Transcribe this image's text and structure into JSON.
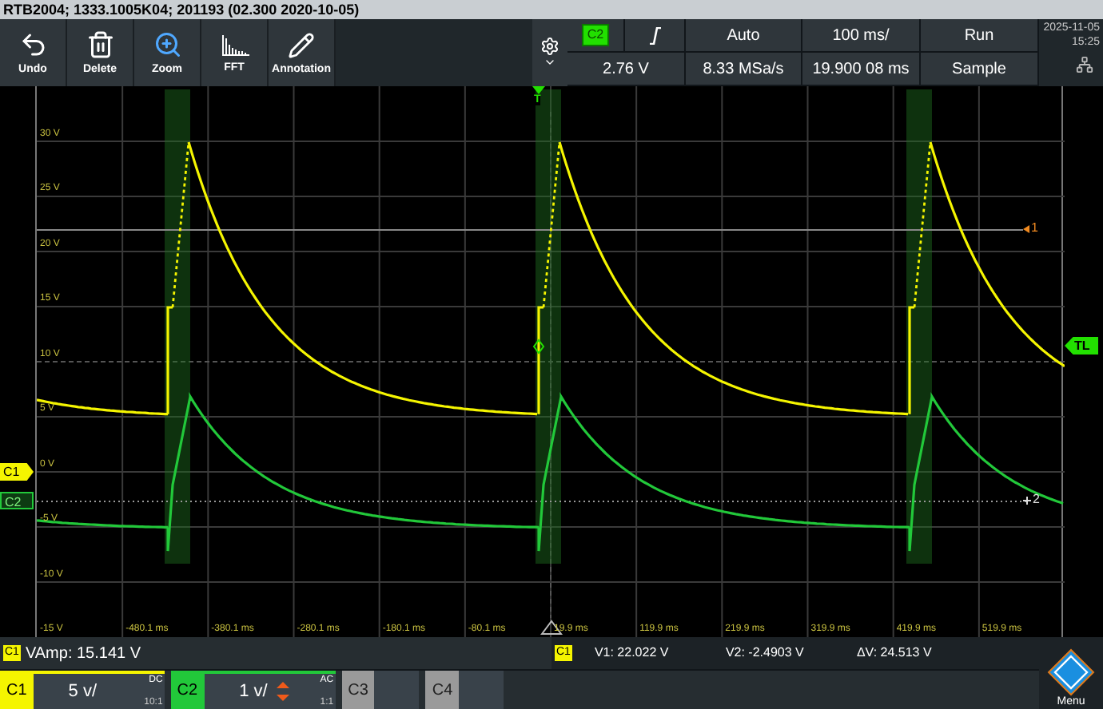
{
  "title_bar": {
    "title": "RTB2004; 1333.1005K04; 201193 (02.300 2020-10-05)"
  },
  "toolbar": [
    {
      "label": "Undo",
      "kind": "undo"
    },
    {
      "label": "Delete",
      "kind": "delete"
    },
    {
      "label": "Zoom",
      "kind": "zoom"
    },
    {
      "label": "FFT",
      "kind": "fft"
    },
    {
      "label": "Annotation",
      "kind": "annotation"
    }
  ],
  "trigger_panel": {
    "source": "C2",
    "level": "2.76 V",
    "mode": "Auto",
    "sample_rate": "8.33 MSa/s",
    "timebase": "100 ms/",
    "position": "19.900 08 ms",
    "run_state": "Run",
    "acquisition": "Sample"
  },
  "datetime": {
    "date": "2025-11-05",
    "time": "15:25"
  },
  "grid": {
    "y_labels": [
      "30 V",
      "25 V",
      "20 V",
      "15 V",
      "10 V",
      "5 V",
      "0 V",
      "-5 V",
      "-10 V",
      "-15 V"
    ],
    "x_labels": [
      "-480.1 ms",
      "-380.1 ms",
      "-280.1 ms",
      "-180.1 ms",
      "-80.1 ms",
      "19.9 ms",
      "119.9 ms",
      "219.9 ms",
      "319.9 ms",
      "419.9 ms",
      "519.9 ms"
    ],
    "markers": {
      "trigger": "T",
      "trigger_level": "TL",
      "cursor_1": "1",
      "cursor_2": "2",
      "channel_1": "C1",
      "channel_2": "C2"
    }
  },
  "measurement": {
    "channel": "C1",
    "text": "VAmp: 15.141 V"
  },
  "cursors": {
    "channel": "C1",
    "v1": "V1: 22.022 V",
    "v2": "V2: -2.4903 V",
    "dv": "ΔV: 24.513 V"
  },
  "channels": [
    {
      "name": "C1",
      "scale": "5 v/",
      "coupling": "DC",
      "probe": "10:1",
      "on": true,
      "color": "#f5f500"
    },
    {
      "name": "C2",
      "scale": "1 v/",
      "coupling": "AC",
      "probe": "1:1",
      "on": true,
      "color": "#22c83a"
    },
    {
      "name": "C3",
      "on": false
    },
    {
      "name": "C4",
      "on": false
    }
  ],
  "menu_label": "Menu"
}
